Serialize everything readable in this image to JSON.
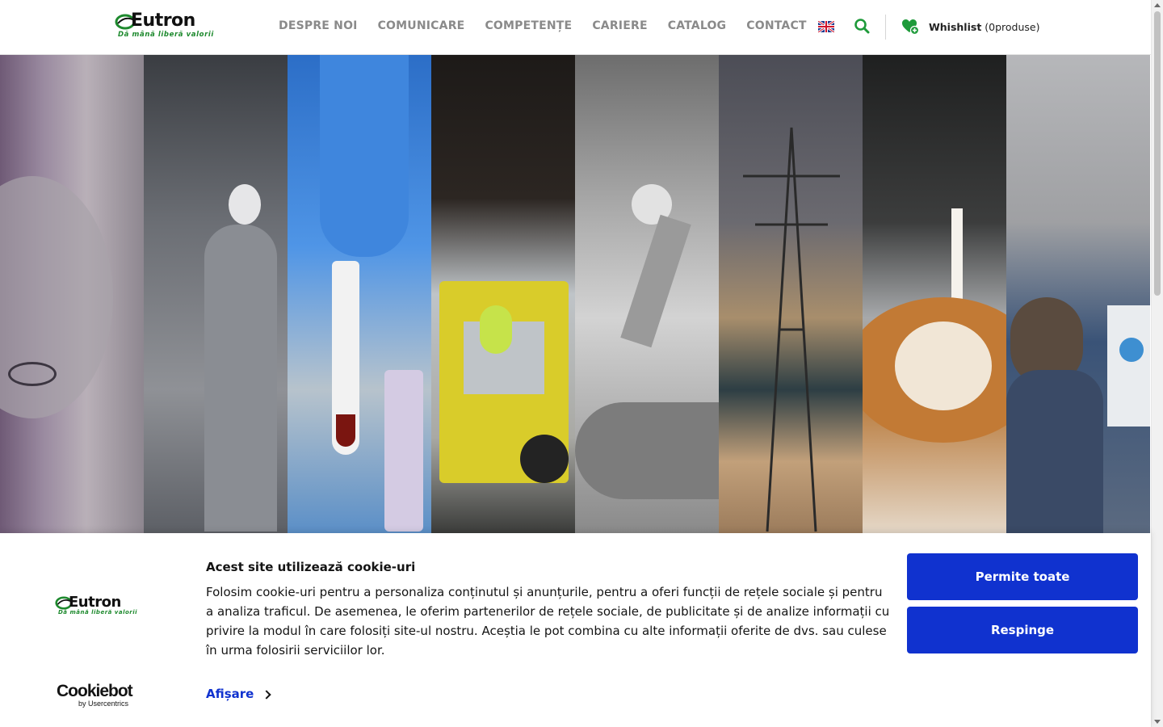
{
  "header": {
    "logo": {
      "word": "Eutron",
      "tagline": "Dă mână liberă valorii"
    },
    "nav": [
      {
        "label": "DESPRE NOI"
      },
      {
        "label": "COMUNICARE"
      },
      {
        "label": "COMPETENȚE"
      },
      {
        "label": "CARIERE"
      },
      {
        "label": "CATALOG"
      },
      {
        "label": "CONTACT"
      }
    ],
    "language_icon": "uk-flag-icon",
    "search_icon": "search-icon",
    "wishlist": {
      "icon": "heart-plus-icon",
      "label": "Whishlist",
      "count_text": "(0produse)"
    }
  },
  "hero": {
    "panels": [
      {
        "name": "banknote-panel"
      },
      {
        "name": "fashion-mannequin-panel"
      },
      {
        "name": "lab-sample-panel"
      },
      {
        "name": "forklift-warehouse-panel"
      },
      {
        "name": "industrial-robot-panel"
      },
      {
        "name": "power-pylon-panel"
      },
      {
        "name": "coffee-latte-panel"
      },
      {
        "name": "office-worker-panel"
      }
    ]
  },
  "cookie": {
    "logo": {
      "word": "Eutron",
      "tagline": "Dă mână liberă valorii"
    },
    "title": "Acest site utilizează cookie-uri",
    "body": "Folosim cookie-uri pentru a personaliza conținutul și anunțurile, pentru a oferi funcții de rețele sociale și pentru a analiza traficul. De asemenea, le oferim partenerilor de rețele sociale, de publicitate și de analize informații cu privire la modul în care folosiți site-ul nostru. Aceștia le pot combina cu alte informații oferite de dvs. sau culese în urma folosirii serviciilor lor.",
    "details_label": "Afișare",
    "allow_label": "Permite toate",
    "deny_label": "Respinge",
    "provider": {
      "name": "Cookiebot",
      "sub": "by Usercentrics"
    }
  },
  "colors": {
    "accent": "#1032cf",
    "brand_green": "#1e8a2e",
    "nav_text": "#8a8a8a"
  }
}
